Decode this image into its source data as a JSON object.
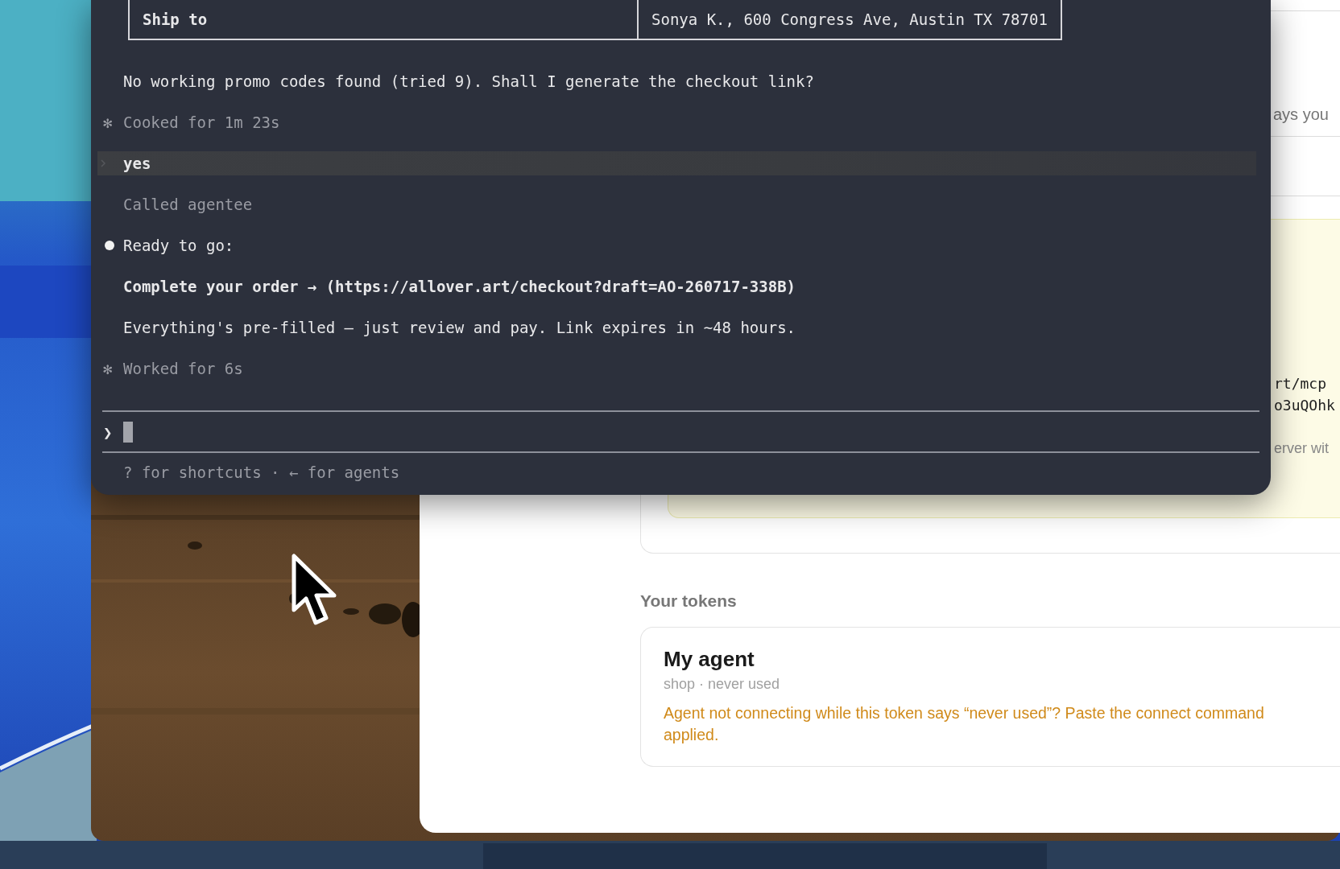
{
  "terminal": {
    "table": {
      "rows": [
        {
          "cells": [
            "Ship to",
            "Sonya K., 600 Congress Ave, Austin TX 78701"
          ]
        }
      ]
    },
    "transcript": [
      {
        "kind": "message",
        "text": "No working promo codes found (tried 9). Shall I generate the checkout link?"
      },
      {
        "kind": "status",
        "marker": "✻",
        "text": "Cooked for 1m 23s"
      },
      {
        "kind": "user",
        "text": "yes"
      },
      {
        "kind": "tool",
        "text": "Called agentee"
      },
      {
        "kind": "bullet",
        "text": "Ready to go:"
      },
      {
        "kind": "strong",
        "text": "Complete your order → (https://allover.art/checkout?draft=AO-260717-338B)"
      },
      {
        "kind": "message",
        "text": "Everything's pre-filled — just review and pay. Link expires in ~48 hours."
      },
      {
        "kind": "status",
        "marker": "✻",
        "text": "Worked for 6s"
      }
    ],
    "prompt": {
      "symbol": "❯"
    },
    "footer": "? for shortcuts · ← for agents"
  },
  "page": {
    "fragments": [
      {
        "kind": "sans",
        "text": "ays you"
      },
      {
        "kind": "mono",
        "text": "rt/mcp"
      },
      {
        "kind": "mono",
        "text": "o3uQOhk"
      },
      {
        "kind": "note",
        "text": "erver wit"
      }
    ],
    "tokens_heading": "Your tokens",
    "tokens": [
      {
        "name": "My agent",
        "meta": "shop · never used",
        "warning": [
          "Agent not connecting while this token says “never used”? Paste the connect command",
          "applied."
        ]
      }
    ]
  }
}
